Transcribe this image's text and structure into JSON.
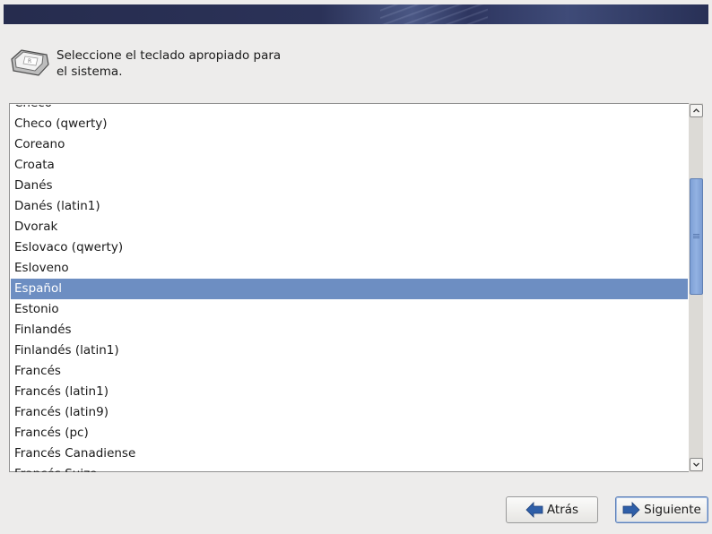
{
  "header": {
    "prompt": "Seleccione el teclado apropiado para el sistema."
  },
  "keyboard_list": {
    "items": [
      {
        "label": "Checo"
      },
      {
        "label": "Checo (qwerty)"
      },
      {
        "label": "Coreano"
      },
      {
        "label": "Croata"
      },
      {
        "label": "Danés"
      },
      {
        "label": "Danés (latin1)"
      },
      {
        "label": "Dvorak"
      },
      {
        "label": "Eslovaco (qwerty)"
      },
      {
        "label": "Esloveno"
      },
      {
        "label": "Español"
      },
      {
        "label": "Estonio"
      },
      {
        "label": "Finlandés"
      },
      {
        "label": "Finlandés (latin1)"
      },
      {
        "label": "Francés"
      },
      {
        "label": "Francés (latin1)"
      },
      {
        "label": "Francés (latin9)"
      },
      {
        "label": "Francés (pc)"
      },
      {
        "label": "Francés Canadiense"
      },
      {
        "label": "Francés Suizo"
      }
    ],
    "selected": "Español"
  },
  "buttons": {
    "back_label": "Atrás",
    "next_label": "Siguiente"
  },
  "icons": {
    "keyboard": "keyboard-key-icon",
    "back": "arrow-left-icon",
    "next": "arrow-right-icon"
  },
  "colors": {
    "selection": "#6d8ec2",
    "arrow": "#2f5fa8"
  }
}
